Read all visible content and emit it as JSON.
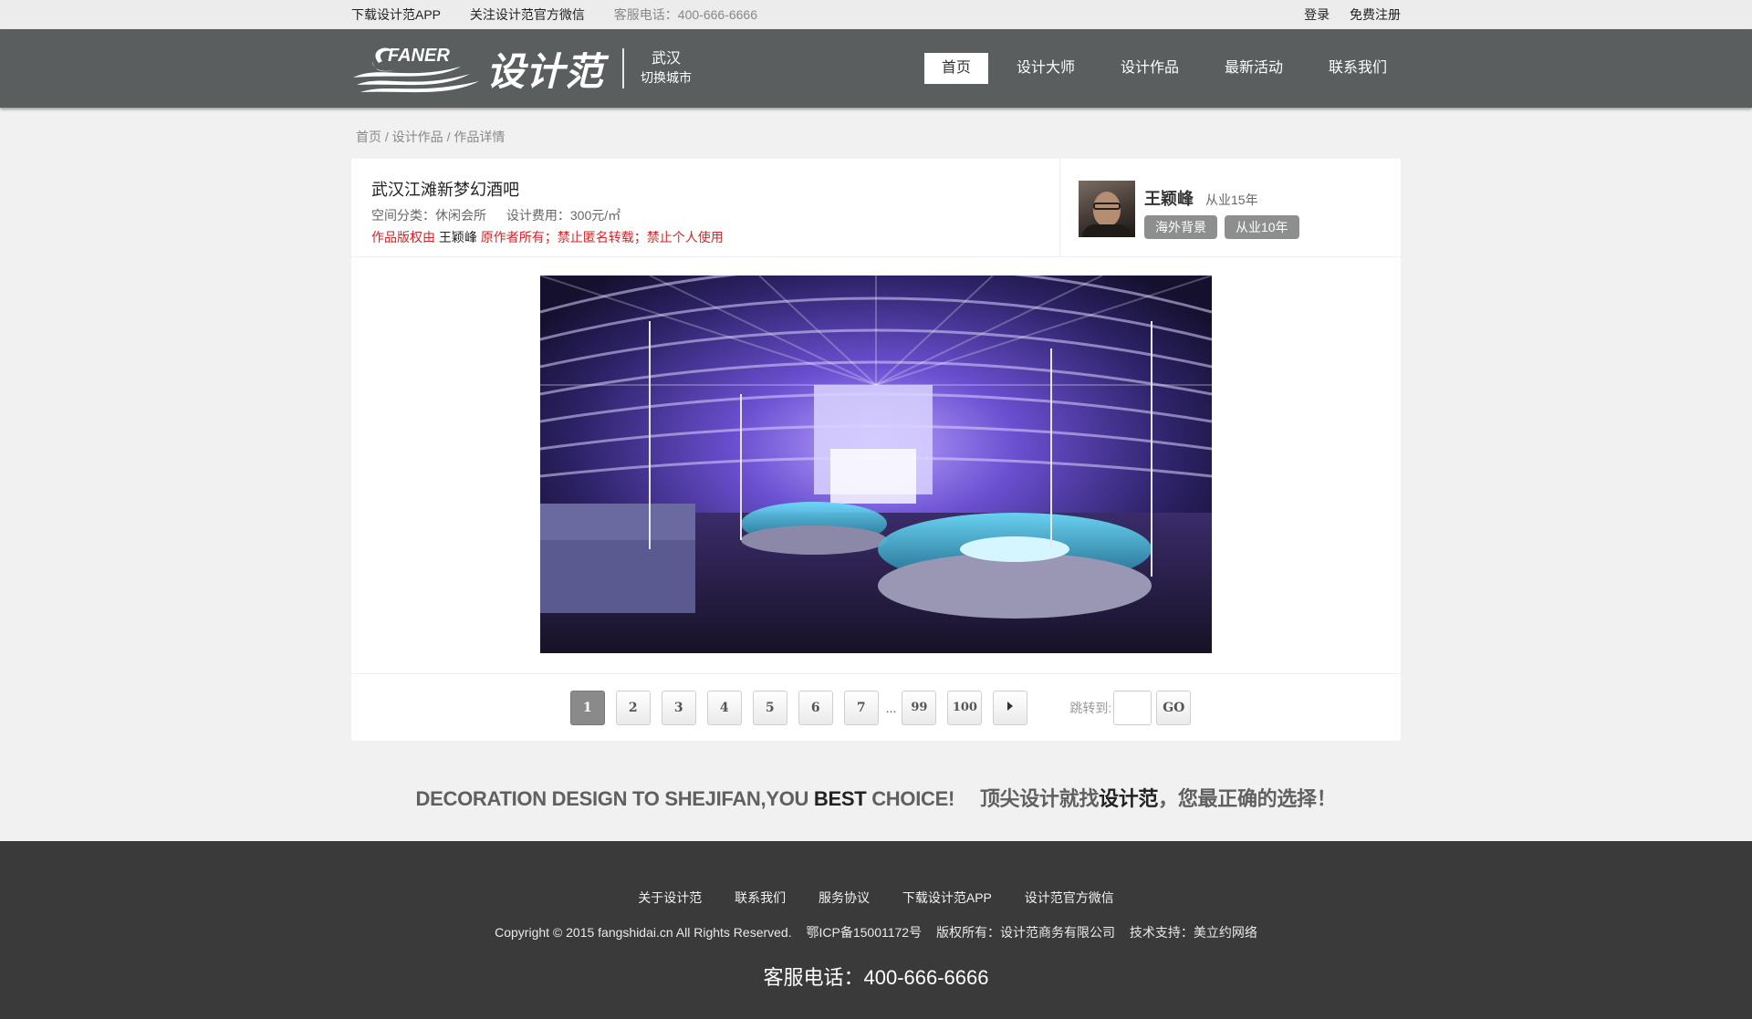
{
  "topbar": {
    "download_app": "下载设计范APP",
    "follow_wechat": "关注设计范官方微信",
    "phone": "客服电话：400-666-6666",
    "login": "登录",
    "register": "免费注册"
  },
  "header": {
    "logo_en": "FANER",
    "logo_cn": "设计范",
    "city": "武汉",
    "switch_city": "切换城市",
    "nav": [
      "首页",
      "设计大师",
      "设计作品",
      "最新活动",
      "联系我们"
    ],
    "nav_active": "首页"
  },
  "breadcrumb": [
    "首页",
    "设计作品",
    "作品详情"
  ],
  "breadcrumb_sep": "/",
  "work": {
    "title": "武汉江滩新梦幻酒吧",
    "category": "空间分类：休闲会所",
    "fee": "设计费用：300元/㎡",
    "copyright_prefix": "作品版权由",
    "copyright_owner": "王颖峰",
    "copyright_suffix": "原作者所有；禁止匿名转载；禁止个人使用"
  },
  "designer": {
    "name": "王颖峰",
    "years": "从业15年",
    "tags": [
      "海外背景",
      "从业10年"
    ]
  },
  "pager": {
    "pages": [
      "1",
      "2",
      "3",
      "4",
      "5",
      "6",
      "7"
    ],
    "ellipsis": "...",
    "tail_pages": [
      "99",
      "100"
    ],
    "current": "1",
    "jump_label": "跳转到:",
    "go": "GO"
  },
  "slogan": {
    "en_pre": "DECORATION DESIGN TO SHEJIFAN,YOU",
    "en_bold": "BEST",
    "en_post": "CHOICE!",
    "cn_pre": "顶尖设计就找",
    "cn_bold": "设计范",
    "cn_post": "，您最正确的选择！"
  },
  "footer": {
    "links": [
      "关于设计范",
      "联系我们",
      "服务协议",
      "下载设计范APP",
      "设计范官方微信"
    ],
    "copyright": "Copyright © 2015 fangshidai.cn All Rights Reserved.",
    "icp": "鄂ICP备15001172号",
    "owner": "版权所有：设计范商务有限公司",
    "tech": "技术支持：美立约网络",
    "phone": "客服电话：400-666-6666"
  },
  "colors": {
    "header_bg": "#5b5e5e",
    "footer_bg": "#3a3a3a",
    "copyright_red": "#d0262b"
  }
}
